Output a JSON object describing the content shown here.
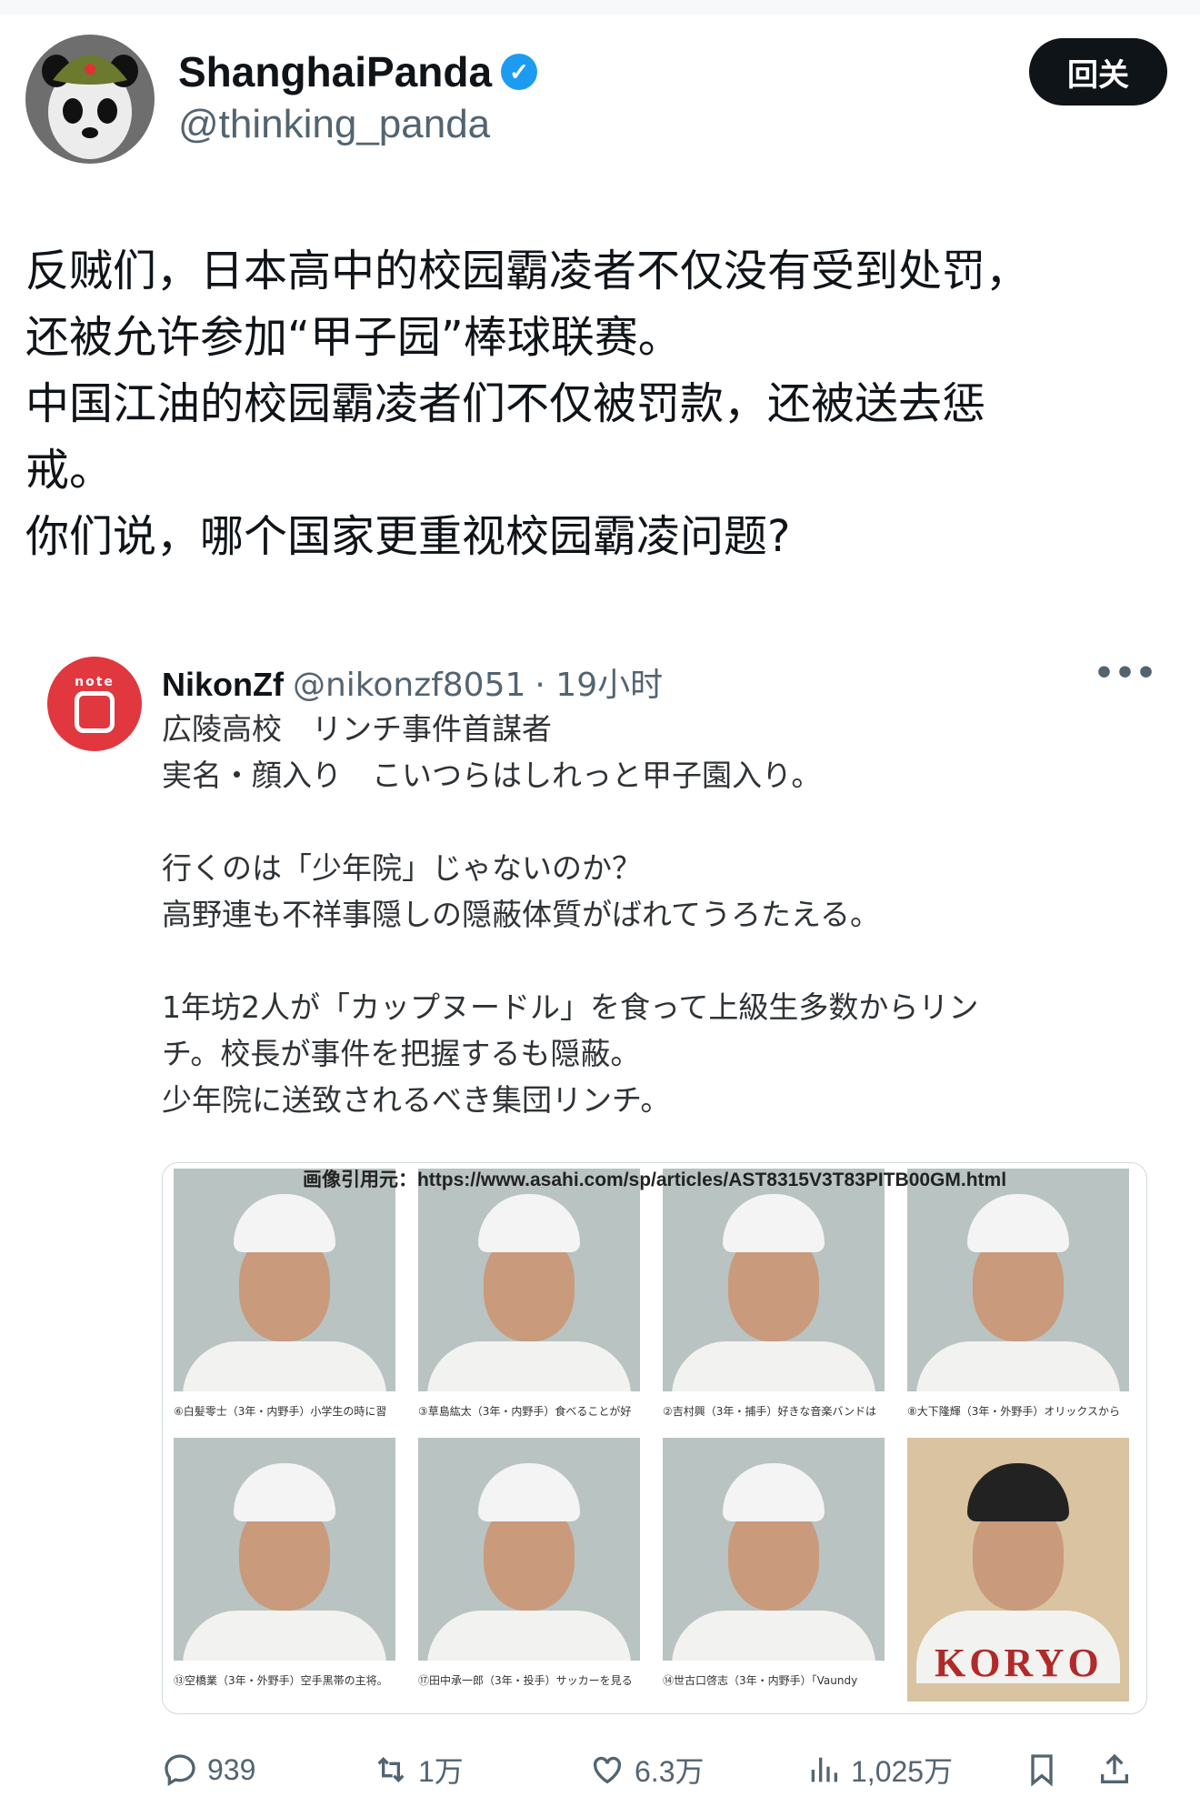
{
  "author": {
    "name": "ShanghaiPanda",
    "handle": "@thinking_panda",
    "verified": true,
    "follow_label": "回关"
  },
  "tweet": {
    "lines": [
      "反贼们，日本高中的校园霸凌者不仅没有受到处罚，",
      "还被允许参加“甲子园”棒球联赛。",
      "中国江油的校园霸凌者们不仅被罚款，还被送去惩",
      "戒。",
      "你们说，哪个国家更重视校园霸凌问题?"
    ]
  },
  "quote": {
    "avatar_text": "note",
    "name": "NikonZf",
    "handle": "@nikonzf8051",
    "time": "· 19小时",
    "more_icon": "•••",
    "lines": [
      "広陵高校　リンチ事件首謀者",
      "実名・顔入り　こいつらはしれっと甲子園入り。",
      "",
      "行くのは「少年院」じゃないのか？",
      "高野連も不祥事隠しの隠蔽体質がばれてうろたえる。",
      "",
      "1年坊2人が「カップヌードル」を食って上級生多数からリン",
      "チ。校長が事件を把握するも隠蔽。",
      "少年院に送致されるべき集団リンチ。"
    ],
    "image": {
      "source": "画像引用元：https://www.asahi.com/sp/articles/AST8315V3T83PITB00GM.html",
      "captions": [
        "⑥白髪零士（3年・内野手）小学生の時に習",
        "③草島紘太（3年・内野手）食べることが好",
        "②吉村興（3年・捕手）好きな音楽バンドは",
        "⑧大下隆輝（3年・外野手）オリックスから",
        "⑬空橋業（3年・外野手）空手黒帯の主将。",
        "⑰田中承一郎（3年・投手）サッカーを見る",
        "⑭世古口啓志（3年・内野手）「Vaundy"
      ],
      "jersey_text": "KORYO"
    }
  },
  "actions": {
    "replies": "939",
    "reposts": "1万",
    "likes": "6.3万",
    "views": "1,025万"
  },
  "colors": {
    "verified": "#1d9bf0",
    "follow_bg": "#0f1419",
    "muted": "#536471"
  }
}
